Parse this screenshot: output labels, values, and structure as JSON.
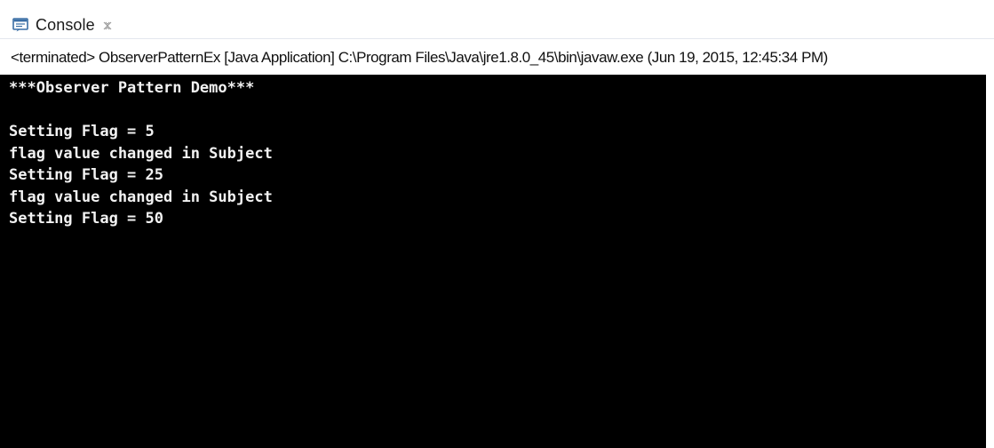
{
  "tab": {
    "label": "Console",
    "icon": "console-icon",
    "close_icon": "close-icon"
  },
  "status_line": "<terminated> ObserverPatternEx [Java Application] C:\\Program Files\\Java\\jre1.8.0_45\\bin\\javaw.exe (Jun 19, 2015, 12:45:34 PM)",
  "console": {
    "lines": [
      "***Observer Pattern Demo***",
      "",
      "Setting Flag = 5",
      "flag value changed in Subject",
      "Setting Flag = 25",
      "flag value changed in Subject",
      "Setting Flag = 50"
    ]
  },
  "colors": {
    "terminal_bg": "#000000",
    "terminal_fg": "#f2f2f2",
    "icon_accent": "#3a6ea5"
  }
}
